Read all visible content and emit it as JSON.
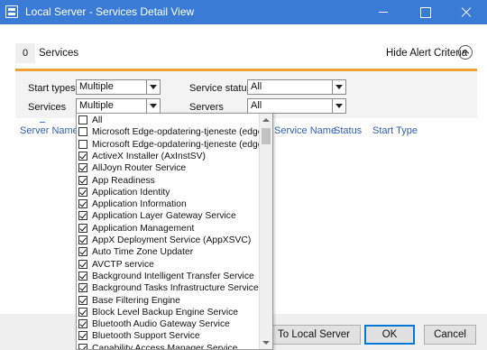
{
  "window": {
    "title": "Local Server - Services Detail View"
  },
  "summary": {
    "count": "0",
    "label": "Services"
  },
  "alert_toggle": {
    "label": "Hide Alert Criteria"
  },
  "criteria": {
    "start_types_label": "Start types",
    "start_types_value": "Multiple",
    "service_status_label": "Service status",
    "service_status_value": "All",
    "services_label": "Services",
    "services_value": "Multiple",
    "servers_label": "Servers",
    "servers_value": "All"
  },
  "grid": {
    "columns": [
      "Server Name",
      "Service Name",
      "Status",
      "Start Type"
    ]
  },
  "footer": {
    "to_local_label": "To Local Server",
    "ok_label": "OK",
    "cancel_label": "Cancel"
  },
  "services_dropdown": {
    "items": [
      {
        "label": "All",
        "checked": false
      },
      {
        "label": "Microsoft Edge-opdatering-tjeneste (edgeupdate)",
        "checked": false
      },
      {
        "label": "Microsoft Edge-opdatering-tjeneste (edgeupdatem)",
        "checked": false
      },
      {
        "label": "ActiveX Installer (AxInstSV)",
        "checked": true
      },
      {
        "label": "AllJoyn Router Service",
        "checked": true
      },
      {
        "label": "App Readiness",
        "checked": true
      },
      {
        "label": "Application Identity",
        "checked": true
      },
      {
        "label": "Application Information",
        "checked": true
      },
      {
        "label": "Application Layer Gateway Service",
        "checked": true
      },
      {
        "label": "Application Management",
        "checked": true
      },
      {
        "label": "AppX Deployment Service (AppXSVC)",
        "checked": true
      },
      {
        "label": "Auto Time Zone Updater",
        "checked": true
      },
      {
        "label": "AVCTP service",
        "checked": true
      },
      {
        "label": "Background Intelligent Transfer Service",
        "checked": true
      },
      {
        "label": "Background Tasks Infrastructure Service",
        "checked": true
      },
      {
        "label": "Base Filtering Engine",
        "checked": true
      },
      {
        "label": "Block Level Backup Engine Service",
        "checked": true
      },
      {
        "label": "Bluetooth Audio Gateway Service",
        "checked": true
      },
      {
        "label": "Bluetooth Support Service",
        "checked": true
      },
      {
        "label": "Capability Access Manager Service",
        "checked": true
      }
    ]
  },
  "colors": {
    "titlebar": "#3a7bd5",
    "criteria_accent": "#f0a030",
    "header_link": "#3060b0"
  }
}
